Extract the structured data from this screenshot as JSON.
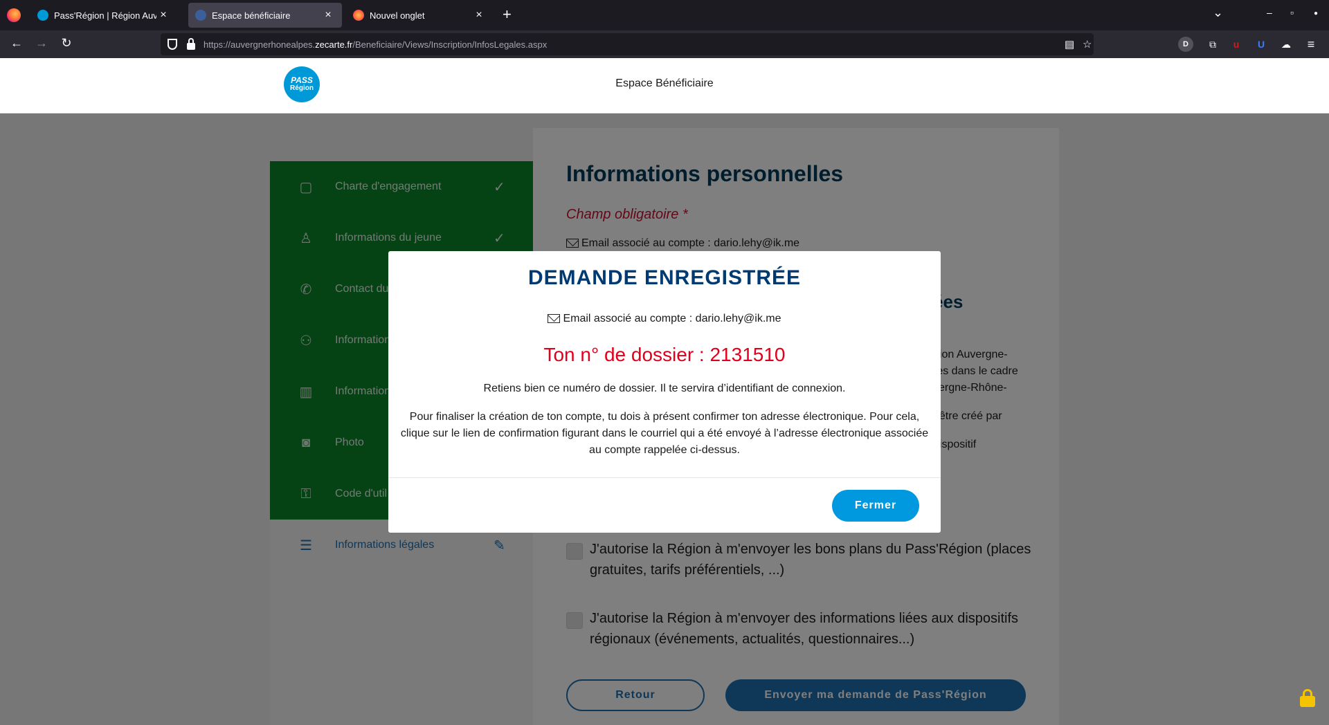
{
  "browser": {
    "tabs": [
      {
        "title": "Pass'Région | Région Auvergne-Rhône-Alpes",
        "active": false
      },
      {
        "title": "Espace bénéficiaire",
        "active": true
      },
      {
        "title": "Nouvel onglet",
        "active": false
      }
    ],
    "url_prefix": "https://auvergnerhonealpes.",
    "url_domain": "zecarte.fr",
    "url_path": "/Beneficiaire/Views/Inscription/InfosLegales.aspx",
    "icons": {
      "new_tab": "+",
      "list_tabs": "⌄",
      "minimize": "–",
      "maximize": "▫",
      "close": "●",
      "back": "←",
      "forward": "→",
      "reload": "↻",
      "reader": "▤",
      "bookmark": "☆",
      "menu": "≡",
      "ext_d": "D",
      "ext_puzzle": "⧉",
      "ext_ublock": "u",
      "ext_bitwarden": "U",
      "ext_cloud": "☁"
    }
  },
  "site": {
    "logo_top": "PASS",
    "logo_bottom": "Région",
    "header_title": "Espace Bénéficiaire"
  },
  "sidebar": {
    "items": [
      {
        "label": "Charte d'engagement",
        "icon": "clipboard-icon",
        "glyph": "▢",
        "done": true
      },
      {
        "label": "Informations du jeune",
        "icon": "person-icon",
        "glyph": "♙",
        "done": true
      },
      {
        "label": "Contact du",
        "icon": "phone-icon",
        "glyph": "✆",
        "done": false
      },
      {
        "label": "Information",
        "icon": "people-icon",
        "glyph": "⚇",
        "done": false
      },
      {
        "label": "Information",
        "icon": "building-icon",
        "glyph": "▥",
        "done": false
      },
      {
        "label": "Photo",
        "icon": "camera-icon",
        "glyph": "◙",
        "done": false
      },
      {
        "label": "Code d'util",
        "icon": "key-icon",
        "glyph": "⚿",
        "done": false
      },
      {
        "label": "Informations légales",
        "icon": "checklist-icon",
        "glyph": "☰",
        "current": true
      }
    ],
    "check_glyph": "✓",
    "edit_glyph": "✎"
  },
  "main": {
    "title": "Informations personnelles",
    "required": "Champ obligatoire *",
    "email_line": "Email associé au compte : dario.lehy@ik.me",
    "section_fragment": "ées",
    "fragments": [
      "gion Auvergne-",
      "res dans le cadre",
      "vergne-Rhône-",
      "t être créé par",
      "dispositif"
    ],
    "checkbox_1": "J'autorise la Région à m'envoyer les bons plans du Pass'Région (places gratuites, tarifs préférentiels, ...)",
    "checkbox_2": "J'autorise la Région à m'envoyer des informations liées aux dispositifs régionaux (événements, actualités, questionnaires...)",
    "btn_back": "Retour",
    "btn_send": "Envoyer ma demande de Pass'Région"
  },
  "modal": {
    "title": "DEMANDE ENREGISTRÉE",
    "email_line": "Email associé au compte : dario.lehy@ik.me",
    "dossier": "Ton n° de dossier : 2131510",
    "para1": "Retiens bien ce numéro de dossier. Il te servira d’identifiant de connexion.",
    "para2": "Pour finaliser la création de ton compte, tu dois à présent confirmer ton adresse électronique. Pour cela, clique sur le lien de confirmation figurant dans le courriel qui a été envoyé à l’adresse électronique associée au compte rappelée ci-dessus.",
    "close_button": "Fermer"
  },
  "colors": {
    "sidebar_green": "#0a8428",
    "title_blue": "#003a5d",
    "modal_title": "#003a72",
    "dossier_red": "#e0001b",
    "button_blue": "#0099e0",
    "required_red": "#c8102e"
  }
}
